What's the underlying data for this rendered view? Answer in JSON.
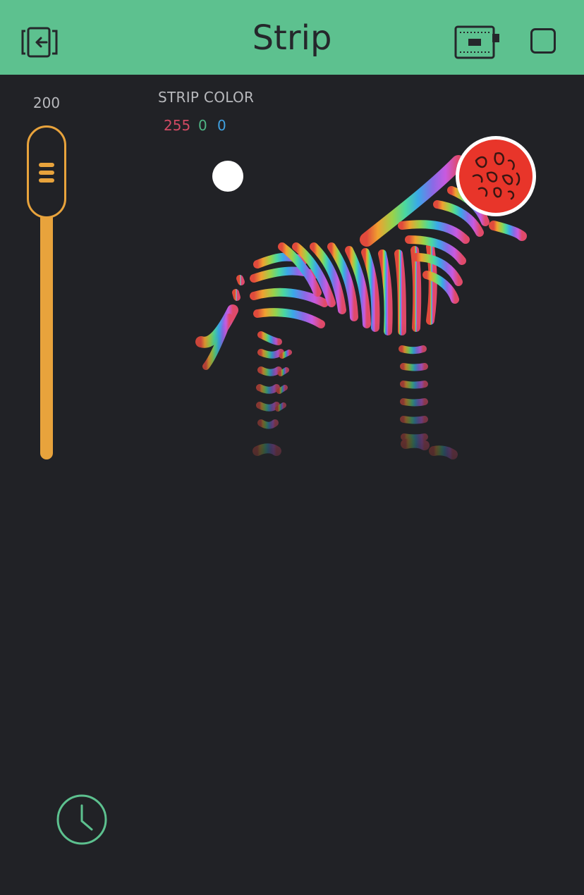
{
  "header": {
    "title": "Strip",
    "exit_icon": "exit-icon",
    "device_icon": "device-chip-icon",
    "stop_icon": "stop-square-icon"
  },
  "brightness_slider": {
    "value": "200"
  },
  "strip_color": {
    "label": "STRIP COLOR",
    "r": "255",
    "g": "0",
    "b": "0",
    "selected_color": "#e8352a"
  },
  "timer": {
    "icon": "clock-icon"
  },
  "colors": {
    "header_bg": "#5dc18f",
    "background": "#212226",
    "slider_accent": "#e8a33c"
  }
}
